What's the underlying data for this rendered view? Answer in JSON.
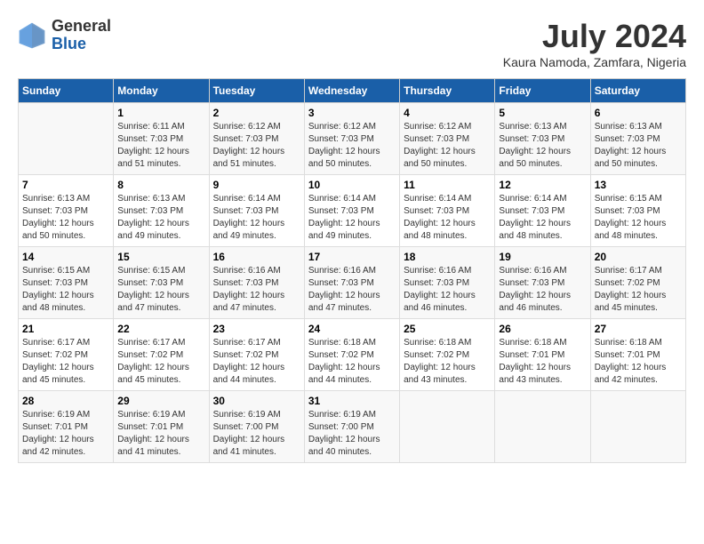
{
  "header": {
    "logo_general": "General",
    "logo_blue": "Blue",
    "month_title": "July 2024",
    "location": "Kaura Namoda, Zamfara, Nigeria"
  },
  "days_of_week": [
    "Sunday",
    "Monday",
    "Tuesday",
    "Wednesday",
    "Thursday",
    "Friday",
    "Saturday"
  ],
  "weeks": [
    [
      {
        "day": "",
        "info": ""
      },
      {
        "day": "1",
        "info": "Sunrise: 6:11 AM\nSunset: 7:03 PM\nDaylight: 12 hours and 51 minutes."
      },
      {
        "day": "2",
        "info": "Sunrise: 6:12 AM\nSunset: 7:03 PM\nDaylight: 12 hours and 51 minutes."
      },
      {
        "day": "3",
        "info": "Sunrise: 6:12 AM\nSunset: 7:03 PM\nDaylight: 12 hours and 50 minutes."
      },
      {
        "day": "4",
        "info": "Sunrise: 6:12 AM\nSunset: 7:03 PM\nDaylight: 12 hours and 50 minutes."
      },
      {
        "day": "5",
        "info": "Sunrise: 6:13 AM\nSunset: 7:03 PM\nDaylight: 12 hours and 50 minutes."
      },
      {
        "day": "6",
        "info": "Sunrise: 6:13 AM\nSunset: 7:03 PM\nDaylight: 12 hours and 50 minutes."
      }
    ],
    [
      {
        "day": "7",
        "info": "Sunrise: 6:13 AM\nSunset: 7:03 PM\nDaylight: 12 hours and 50 minutes."
      },
      {
        "day": "8",
        "info": "Sunrise: 6:13 AM\nSunset: 7:03 PM\nDaylight: 12 hours and 49 minutes."
      },
      {
        "day": "9",
        "info": "Sunrise: 6:14 AM\nSunset: 7:03 PM\nDaylight: 12 hours and 49 minutes."
      },
      {
        "day": "10",
        "info": "Sunrise: 6:14 AM\nSunset: 7:03 PM\nDaylight: 12 hours and 49 minutes."
      },
      {
        "day": "11",
        "info": "Sunrise: 6:14 AM\nSunset: 7:03 PM\nDaylight: 12 hours and 48 minutes."
      },
      {
        "day": "12",
        "info": "Sunrise: 6:14 AM\nSunset: 7:03 PM\nDaylight: 12 hours and 48 minutes."
      },
      {
        "day": "13",
        "info": "Sunrise: 6:15 AM\nSunset: 7:03 PM\nDaylight: 12 hours and 48 minutes."
      }
    ],
    [
      {
        "day": "14",
        "info": "Sunrise: 6:15 AM\nSunset: 7:03 PM\nDaylight: 12 hours and 48 minutes."
      },
      {
        "day": "15",
        "info": "Sunrise: 6:15 AM\nSunset: 7:03 PM\nDaylight: 12 hours and 47 minutes."
      },
      {
        "day": "16",
        "info": "Sunrise: 6:16 AM\nSunset: 7:03 PM\nDaylight: 12 hours and 47 minutes."
      },
      {
        "day": "17",
        "info": "Sunrise: 6:16 AM\nSunset: 7:03 PM\nDaylight: 12 hours and 47 minutes."
      },
      {
        "day": "18",
        "info": "Sunrise: 6:16 AM\nSunset: 7:03 PM\nDaylight: 12 hours and 46 minutes."
      },
      {
        "day": "19",
        "info": "Sunrise: 6:16 AM\nSunset: 7:03 PM\nDaylight: 12 hours and 46 minutes."
      },
      {
        "day": "20",
        "info": "Sunrise: 6:17 AM\nSunset: 7:02 PM\nDaylight: 12 hours and 45 minutes."
      }
    ],
    [
      {
        "day": "21",
        "info": "Sunrise: 6:17 AM\nSunset: 7:02 PM\nDaylight: 12 hours and 45 minutes."
      },
      {
        "day": "22",
        "info": "Sunrise: 6:17 AM\nSunset: 7:02 PM\nDaylight: 12 hours and 45 minutes."
      },
      {
        "day": "23",
        "info": "Sunrise: 6:17 AM\nSunset: 7:02 PM\nDaylight: 12 hours and 44 minutes."
      },
      {
        "day": "24",
        "info": "Sunrise: 6:18 AM\nSunset: 7:02 PM\nDaylight: 12 hours and 44 minutes."
      },
      {
        "day": "25",
        "info": "Sunrise: 6:18 AM\nSunset: 7:02 PM\nDaylight: 12 hours and 43 minutes."
      },
      {
        "day": "26",
        "info": "Sunrise: 6:18 AM\nSunset: 7:01 PM\nDaylight: 12 hours and 43 minutes."
      },
      {
        "day": "27",
        "info": "Sunrise: 6:18 AM\nSunset: 7:01 PM\nDaylight: 12 hours and 42 minutes."
      }
    ],
    [
      {
        "day": "28",
        "info": "Sunrise: 6:19 AM\nSunset: 7:01 PM\nDaylight: 12 hours and 42 minutes."
      },
      {
        "day": "29",
        "info": "Sunrise: 6:19 AM\nSunset: 7:01 PM\nDaylight: 12 hours and 41 minutes."
      },
      {
        "day": "30",
        "info": "Sunrise: 6:19 AM\nSunset: 7:00 PM\nDaylight: 12 hours and 41 minutes."
      },
      {
        "day": "31",
        "info": "Sunrise: 6:19 AM\nSunset: 7:00 PM\nDaylight: 12 hours and 40 minutes."
      },
      {
        "day": "",
        "info": ""
      },
      {
        "day": "",
        "info": ""
      },
      {
        "day": "",
        "info": ""
      }
    ]
  ]
}
